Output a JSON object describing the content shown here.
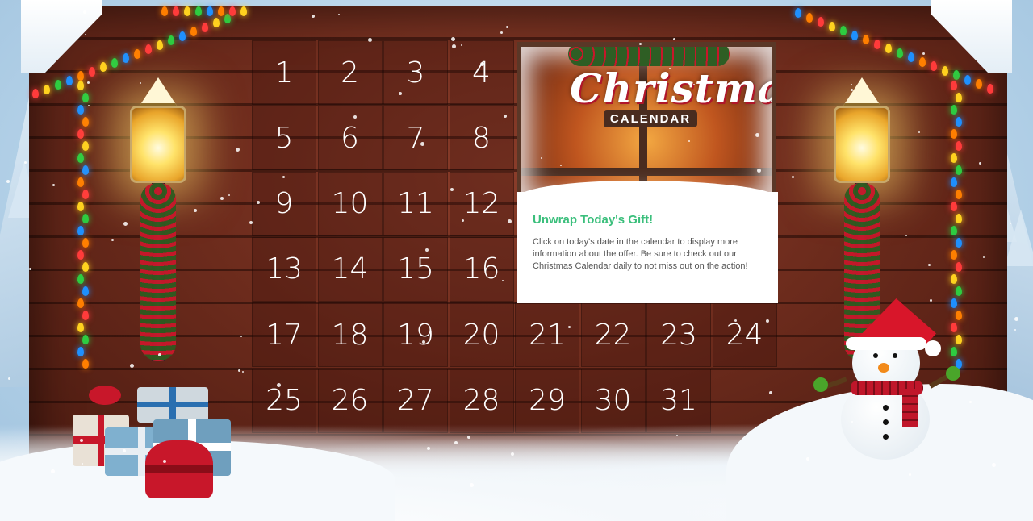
{
  "calendar": {
    "days": [
      "1",
      "2",
      "3",
      "4",
      "5",
      "6",
      "7",
      "8",
      "9",
      "10",
      "11",
      "12",
      "13",
      "14",
      "15",
      "16",
      "17",
      "18",
      "19",
      "20",
      "21",
      "22",
      "23",
      "24",
      "25",
      "26",
      "27",
      "28",
      "29",
      "30",
      "31"
    ]
  },
  "logo": {
    "title": "Christmas",
    "subtitle": "CALENDAR"
  },
  "info": {
    "heading": "Unwrap Today's Gift!",
    "body": "Click on today's date in the calendar to display more information about the offer. Be sure to check out our Christmas Calendar daily to not miss out on the action!"
  },
  "colors": {
    "heading_green": "#3bbf7c",
    "wood": "#6e2c1d",
    "text_white": "#ffffff"
  }
}
